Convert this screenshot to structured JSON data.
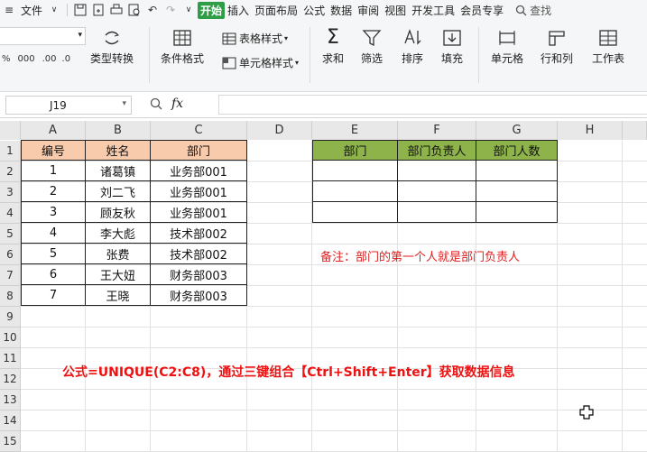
{
  "menubar": {
    "file": "文件",
    "tabs": [
      "开始",
      "插入",
      "页面布局",
      "公式",
      "数据",
      "审阅",
      "视图",
      "开发工具",
      "会员专享"
    ],
    "search": "查找"
  },
  "ribbon": {
    "font_size_partial": "",
    "type_convert": "类型转换",
    "cond_format": "条件格式",
    "table_style": "表格样式",
    "cell_style": "单元格样式",
    "sum": "求和",
    "filter": "筛选",
    "sort": "排序",
    "fill": "填充",
    "cell": "单元格",
    "row_col": "行和列",
    "worksheet": "工作表"
  },
  "formula_bar": {
    "name_box": "J19",
    "fx": "fx",
    "content": ""
  },
  "columns": [
    "A",
    "B",
    "C",
    "D",
    "E",
    "F",
    "G",
    "H"
  ],
  "rows": [
    "1",
    "2",
    "3",
    "4",
    "5",
    "6",
    "7",
    "8",
    "9",
    "10",
    "11",
    "12",
    "13",
    "14",
    "15"
  ],
  "table1": {
    "headers": [
      "编号",
      "姓名",
      "部门"
    ],
    "rows": [
      [
        "1",
        "诸葛镇",
        "业务部001"
      ],
      [
        "2",
        "刘二飞",
        "业务部001"
      ],
      [
        "3",
        "顾友秋",
        "业务部001"
      ],
      [
        "4",
        "李大彪",
        "技术部002"
      ],
      [
        "5",
        "张费",
        "技术部002"
      ],
      [
        "6",
        "王大妞",
        "财务部003"
      ],
      [
        "7",
        "王晓",
        "财务部003"
      ]
    ]
  },
  "table2": {
    "headers": [
      "部门",
      "部门负责人",
      "部门人数"
    ]
  },
  "note": "备注：部门的第一个人就是部门负责人",
  "formula_note": "公式=UNIQUE(C2:C8)，通过三键组合【Ctrl+Shift+Enter】获取数据信息",
  "colors": {
    "header1": "#f8cbad",
    "header2": "#8db34a",
    "accent": "#2e9e46",
    "note": "#e02020"
  }
}
